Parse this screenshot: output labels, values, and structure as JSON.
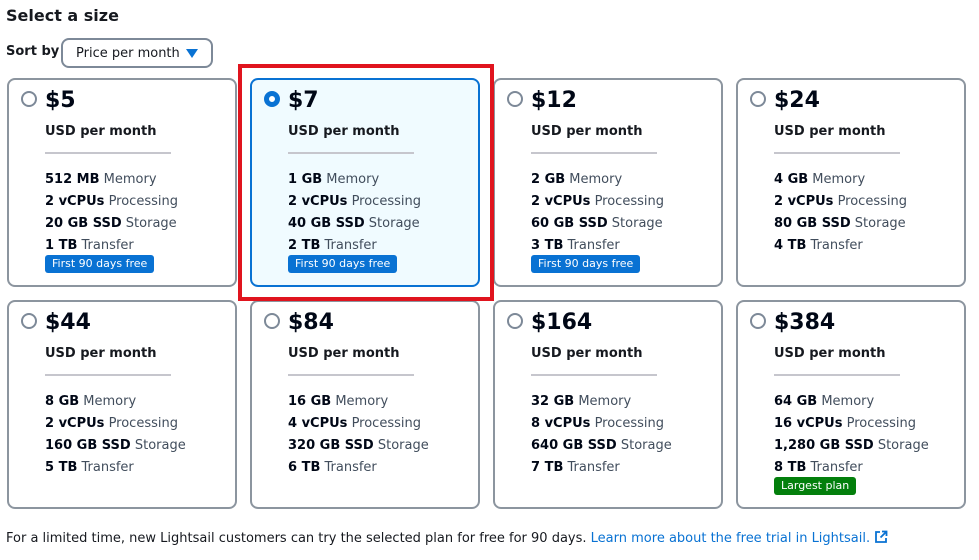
{
  "title": "Select a size",
  "sort": {
    "label": "Sort by",
    "selected": "Price per month"
  },
  "plans": [
    {
      "price": "$5",
      "unit": "USD per month",
      "memory": "512 MB",
      "memory_label": "Memory",
      "cpu": "2 vCPUs",
      "cpu_label": "Processing",
      "storage": "20 GB SSD",
      "storage_label": "Storage",
      "transfer": "1 TB",
      "transfer_label": "Transfer",
      "badge": "First 90 days free",
      "selected": false
    },
    {
      "price": "$7",
      "unit": "USD per month",
      "memory": "1 GB",
      "memory_label": "Memory",
      "cpu": "2 vCPUs",
      "cpu_label": "Processing",
      "storage": "40 GB SSD",
      "storage_label": "Storage",
      "transfer": "2 TB",
      "transfer_label": "Transfer",
      "badge": "First 90 days free",
      "selected": true
    },
    {
      "price": "$12",
      "unit": "USD per month",
      "memory": "2 GB",
      "memory_label": "Memory",
      "cpu": "2 vCPUs",
      "cpu_label": "Processing",
      "storage": "60 GB SSD",
      "storage_label": "Storage",
      "transfer": "3 TB",
      "transfer_label": "Transfer",
      "badge": "First 90 days free",
      "selected": false
    },
    {
      "price": "$24",
      "unit": "USD per month",
      "memory": "4 GB",
      "memory_label": "Memory",
      "cpu": "2 vCPUs",
      "cpu_label": "Processing",
      "storage": "80 GB SSD",
      "storage_label": "Storage",
      "transfer": "4 TB",
      "transfer_label": "Transfer",
      "badge": "",
      "selected": false
    },
    {
      "price": "$44",
      "unit": "USD per month",
      "memory": "8 GB",
      "memory_label": "Memory",
      "cpu": "2 vCPUs",
      "cpu_label": "Processing",
      "storage": "160 GB SSD",
      "storage_label": "Storage",
      "transfer": "5 TB",
      "transfer_label": "Transfer",
      "badge": "",
      "selected": false
    },
    {
      "price": "$84",
      "unit": "USD per month",
      "memory": "16 GB",
      "memory_label": "Memory",
      "cpu": "4 vCPUs",
      "cpu_label": "Processing",
      "storage": "320 GB SSD",
      "storage_label": "Storage",
      "transfer": "6 TB",
      "transfer_label": "Transfer",
      "badge": "",
      "selected": false
    },
    {
      "price": "$164",
      "unit": "USD per month",
      "memory": "32 GB",
      "memory_label": "Memory",
      "cpu": "8 vCPUs",
      "cpu_label": "Processing",
      "storage": "640 GB SSD",
      "storage_label": "Storage",
      "transfer": "7 TB",
      "transfer_label": "Transfer",
      "badge": "",
      "selected": false
    },
    {
      "price": "$384",
      "unit": "USD per month",
      "memory": "64 GB",
      "memory_label": "Memory",
      "cpu": "16 vCPUs",
      "cpu_label": "Processing",
      "storage": "1,280 GB SSD",
      "storage_label": "Storage",
      "transfer": "8 TB",
      "transfer_label": "Transfer",
      "badge": "Largest plan",
      "selected": false
    }
  ],
  "footer": {
    "text": "For a limited time, new Lightsail customers can try the selected plan for free for 90 days.",
    "link": "Learn more about the free trial in Lightsail."
  },
  "colors": {
    "accent": "#0972d3",
    "highlight": "#e0141e",
    "success": "#037f0c",
    "selected_bg": "#f0fbff"
  },
  "icons": {
    "sort_caret": "caret-down-icon",
    "external_link": "external-link-icon"
  }
}
